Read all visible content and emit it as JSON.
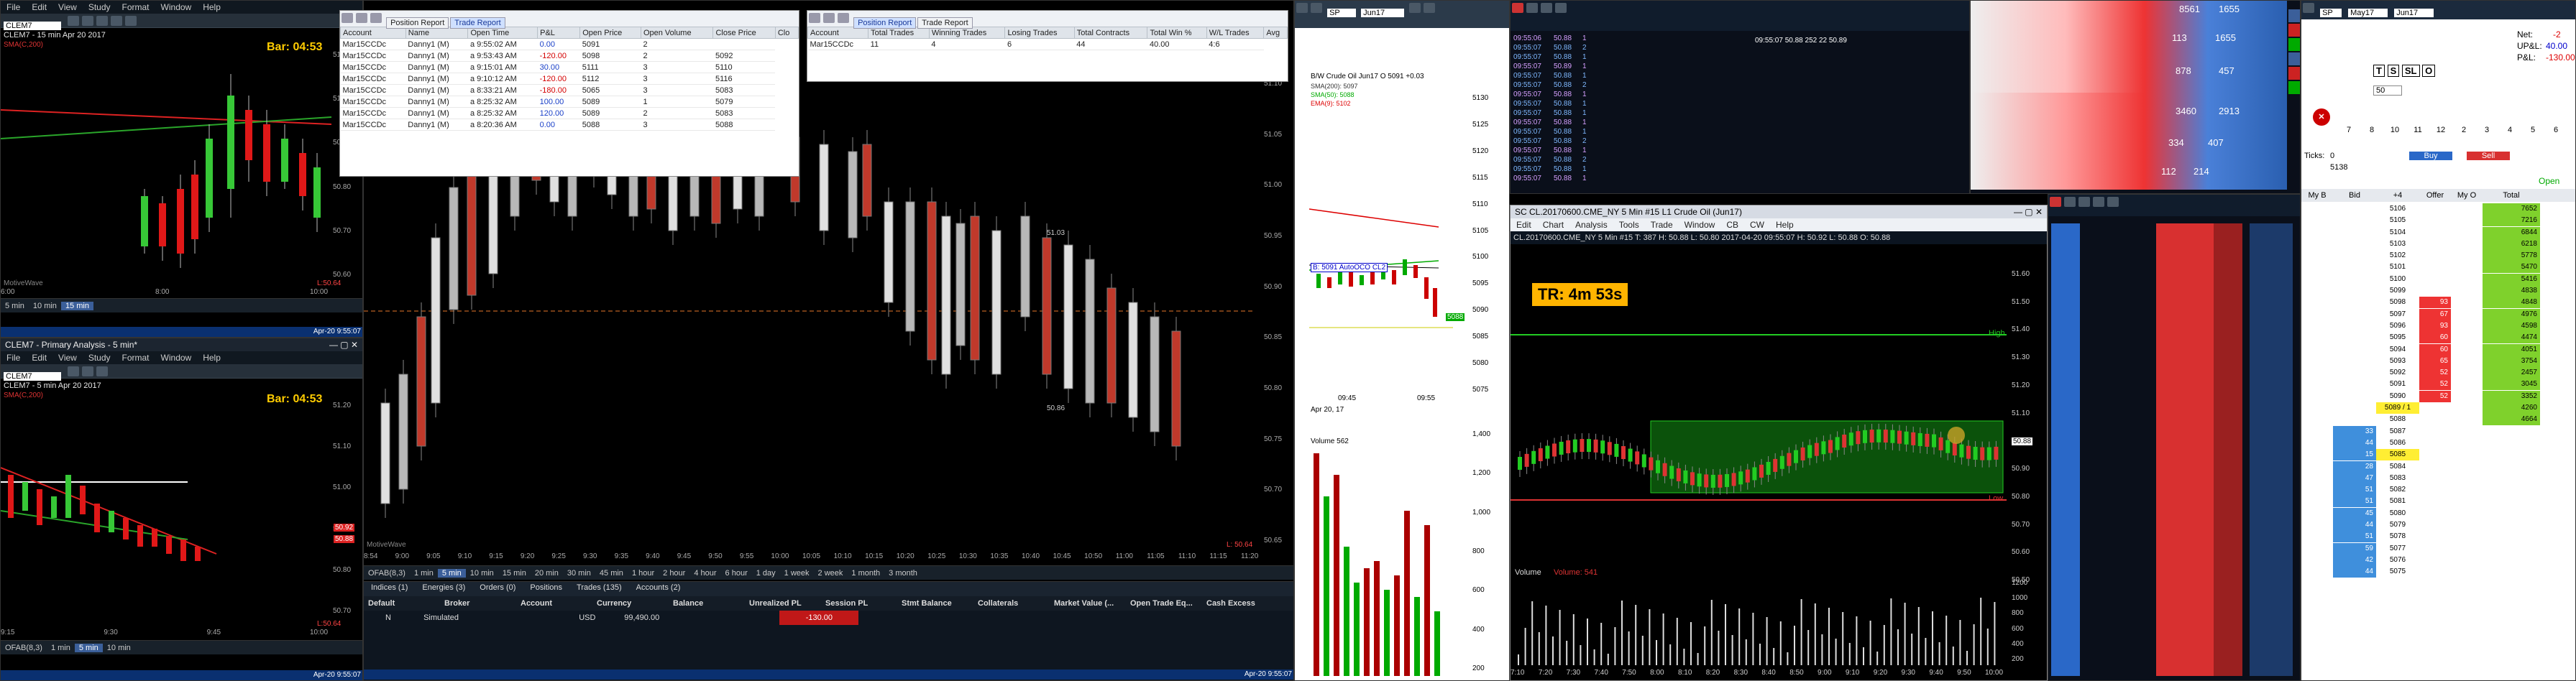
{
  "clem7_top": {
    "title": "CLEM7 - 15 min",
    "menu": [
      "File",
      "Edit",
      "View",
      "Study",
      "Format",
      "Window",
      "Help"
    ],
    "symbol": "CLEM7",
    "header_line": "CLEM7 - 15 min  Apr 20 2017",
    "sma": "SMA(C,200)",
    "bar_countdown": "Bar: 04:53",
    "price_labels": [
      "51.10",
      "51.00",
      "50.90",
      "50.80",
      "50.70",
      "50.60"
    ],
    "low_label": "L:50.64",
    "watermark": "MotiveWave",
    "timeframes": [
      "5 min",
      "10 min",
      "15 min"
    ],
    "time_labels": [
      "6:00",
      "8:00",
      "10:00"
    ],
    "status_date": "Apr-20 9:55:07"
  },
  "clem7_bottom": {
    "title": "CLEM7 - Primary Analysis - 5 min*",
    "menu": [
      "File",
      "Edit",
      "View",
      "Study",
      "Format",
      "Window",
      "Help"
    ],
    "symbol": "CLEM7",
    "header_line": "CLEM7 - 5 min  Apr 20 2017",
    "sma": "SMA(C,200)",
    "bar_countdown": "Bar: 04:53",
    "price_labels": [
      "51.20",
      "51.10",
      "51.00",
      "50.90",
      "50.80",
      "50.70"
    ],
    "price_tags": [
      "50.92",
      "50.88"
    ],
    "low_label": "L:50.64",
    "time_labels": [
      "9:15",
      "9:30",
      "9:45",
      "10:00"
    ],
    "timeframes": [
      "OFAB(8,3)",
      "1 min",
      "5 min",
      "10 min"
    ],
    "status_date": "Apr-20 9:55:07"
  },
  "position_report": {
    "tabs": [
      "Position Report",
      "Trade Report"
    ],
    "columns": [
      "Account",
      "Name",
      "Open Time",
      "P&L",
      "Open Price",
      "Open Volume",
      "Close Price",
      "Clo"
    ],
    "rows": [
      [
        "Mar15CCDc",
        "Danny1 (M)",
        "a 9:55:02 AM",
        "0.00",
        "5091",
        "2",
        ""
      ],
      [
        "Mar15CCDc",
        "Danny1 (M)",
        "a 9:53:43 AM",
        "-120.00",
        "5098",
        "2",
        "5092"
      ],
      [
        "Mar15CCDc",
        "Danny1 (M)",
        "a 9:15:01 AM",
        "30.00",
        "5111",
        "3",
        "5110"
      ],
      [
        "Mar15CCDc",
        "Danny1 (M)",
        "a 9:10:12 AM",
        "-120.00",
        "5112",
        "3",
        "5116"
      ],
      [
        "Mar15CCDc",
        "Danny1 (M)",
        "a 8:33:21 AM",
        "-180.00",
        "5065",
        "3",
        "5083"
      ],
      [
        "Mar15CCDc",
        "Danny1 (M)",
        "a 8:25:32 AM",
        "100.00",
        "5089",
        "1",
        "5079"
      ],
      [
        "Mar15CCDc",
        "Danny1 (M)",
        "a 8:25:32 AM",
        "120.00",
        "5089",
        "2",
        "5083"
      ],
      [
        "Mar15CCDc",
        "Danny1 (M)",
        "a 8:20:36 AM",
        "0.00",
        "5088",
        "3",
        "5088"
      ]
    ]
  },
  "trade_report": {
    "tabs": [
      "Position Report",
      "Trade Report"
    ],
    "columns": [
      "Account",
      "Total Trades",
      "Winning Trades",
      "Losing Trades",
      "Total Contracts",
      "Total Win %",
      "W/L Trades",
      "Avg"
    ],
    "rows": [
      [
        "Mar15CCDc",
        "11",
        "4",
        "6",
        "44",
        "40.00",
        "4:6"
      ]
    ]
  },
  "main_chart": {
    "price_labels": [
      "51.10",
      "51.05",
      "51.00",
      "50.95",
      "50.90",
      "50.85",
      "50.80",
      "50.75",
      "50.70",
      "50.65"
    ],
    "inner_labels": [
      "51.03",
      "50.86"
    ],
    "low_label": "L: 50.64",
    "watermark": "MotiveWave",
    "time_labels": [
      "8:54",
      "9:00",
      "9:05",
      "9:10",
      "9:15",
      "9:20",
      "9:25",
      "9:30",
      "9:35",
      "9:40",
      "9:45",
      "9:50",
      "9:55",
      "10:00",
      "10:05",
      "10:10",
      "10:15",
      "10:20",
      "10:25",
      "10:30",
      "10:35",
      "10:40",
      "10:45",
      "10:50",
      "11:00",
      "11:05",
      "11:10",
      "11:15",
      "11:20"
    ],
    "toolbar": [
      "OFAB(8,3)",
      "1 min",
      "5 min",
      "10 min",
      "15 min",
      "20 min",
      "30 min",
      "45 min",
      "1 hour",
      "2 hour",
      "4 hour",
      "6 hour",
      "1 day",
      "1 week",
      "2 week",
      "1 month",
      "3 month"
    ]
  },
  "accounts_panel": {
    "tabs": [
      "Indices (1)",
      "Energies (3)",
      "Orders (0)",
      "Positions",
      "Trades (135)",
      "Accounts (2)"
    ],
    "columns": [
      "Default",
      "Broker",
      "Account",
      "Currency",
      "Balance",
      "Unrealized PL",
      "Session PL",
      "Stmt Balance",
      "Collaterals",
      "Market Value (...",
      "Open Trade Eq...",
      "Cash Excess"
    ],
    "row": {
      "default": "N",
      "broker": "Simulated",
      "account": "",
      "currency": "USD",
      "balance": "99,490.00",
      "unrealized": "",
      "session_pl": "-130.00"
    },
    "status_date": "Apr-20 9:55:07"
  },
  "small_chart": {
    "title": "B/W Crude Oil Jun17 O 5091 +0.03",
    "legend": [
      "SMA(200): 5097",
      "SMA(50): 5088",
      "EMA(9): 5102"
    ],
    "price_labels": [
      "5130",
      "5125",
      "5120",
      "5115",
      "5110",
      "5105",
      "5100",
      "5095",
      "5090",
      "5085",
      "5080",
      "5075"
    ],
    "autooco": "B: 5091 AutoOCO CL2",
    "tag_price": "5088",
    "time_labels": [
      "09:45",
      "09:55"
    ],
    "date_label": "Apr 20, 17",
    "symbol_box": "SP",
    "contract": "Jun17",
    "volume_label": "Volume 562",
    "volume_axis": [
      "1,400",
      "1,200",
      "1,000",
      "800",
      "600",
      "400",
      "200"
    ]
  },
  "cl_chart": {
    "title": "SC CL.20170600.CME_NY  5 Min  #15  L1  Crude Oil (Jun17)",
    "menu": [
      "Edit",
      "Chart",
      "Analysis",
      "Tools",
      "Trade",
      "Window",
      "CB",
      "CW",
      "Help"
    ],
    "header": "CL.20170600.CME_NY  5 Min  #15  T: 387  H: 50.88  L: 50.80   2017-04-20 09:55:07  H: 50.92  L: 50.88  O: 50.88",
    "tr_label": "TR: 4m 53s",
    "high_label": "High",
    "low_label": "Low",
    "price_labels": [
      "51.60",
      "51.50",
      "51.40",
      "51.30",
      "51.20",
      "51.10",
      "51.00",
      "50.90",
      "50.80",
      "50.70",
      "50.60",
      "50.50"
    ],
    "current_price": "50.88",
    "volume_label": "Volume",
    "volume_value": "Volume: 541",
    "volume_axis": [
      "1200",
      "1000",
      "800",
      "600",
      "400",
      "200"
    ],
    "time_labels": [
      "7:10",
      "7:20",
      "7:30",
      "7:40",
      "7:50",
      "8:00",
      "8:10",
      "8:20",
      "8:30",
      "8:40",
      "8:50",
      "9:00",
      "9:10",
      "9:20",
      "9:30",
      "9:40",
      "9:50",
      "10:00"
    ]
  },
  "time_sales": {
    "rows": [
      [
        "09:55:06",
        "50.88",
        "1"
      ],
      [
        "09:55:07",
        "50.88",
        "2"
      ],
      [
        "09:55:07",
        "50.88",
        "1"
      ],
      [
        "09:55:07",
        "50.89",
        "1"
      ],
      [
        "09:55:07",
        "50.88",
        "1"
      ],
      [
        "09:55:07",
        "50.88",
        "2"
      ],
      [
        "09:55:07",
        "50.88",
        "1"
      ],
      [
        "09:55:07",
        "50.88",
        "1"
      ],
      [
        "09:55:07",
        "50.88",
        "1"
      ],
      [
        "09:55:07",
        "50.88",
        "1"
      ],
      [
        "09:55:07",
        "50.88",
        "1"
      ],
      [
        "09:55:07",
        "50.88",
        "2"
      ],
      [
        "09:55:07",
        "50.88",
        "1"
      ],
      [
        "09:55:07",
        "50.88",
        "2"
      ],
      [
        "09:55:07",
        "50.88",
        "1"
      ],
      [
        "09:55:07",
        "50.88",
        "1"
      ]
    ],
    "dom_header": "09:55:07  50.88  252  22  50.89"
  },
  "order_ticket": {
    "symbol": "SP",
    "contract": "May17",
    "contract2": "Jun17",
    "net": "-2",
    "upl": "40.00",
    "pl": "-130.00",
    "net_label": "Net:",
    "upl_label": "UP&L:",
    "pl_label": "P&L:",
    "qty": "50",
    "ticks_label": "Ticks:",
    "ticks": "0",
    "price_5138": "5138",
    "buy": "Buy",
    "sell": "Sell",
    "open": "Open",
    "buttons": [
      "T",
      "S",
      "SL",
      "O"
    ],
    "header_nums": [
      "7",
      "8",
      "10",
      "11",
      "12",
      "2",
      "3",
      "4",
      "5",
      "6"
    ]
  },
  "dom_ladder": {
    "columns": [
      "My B",
      "Bid",
      "+4",
      "Offer",
      "My O",
      "Total"
    ],
    "prices": [
      "5106",
      "5105",
      "5104",
      "5103",
      "5102",
      "5101",
      "5100",
      "5099",
      "5098",
      "5097",
      "5096",
      "5095",
      "5094",
      "5093",
      "5092",
      "5091",
      "5090",
      "5089",
      "5088",
      "5087",
      "5086",
      "5085",
      "5084",
      "5083",
      "5082",
      "5081",
      "5080",
      "5079",
      "5078",
      "5077",
      "5076",
      "5075"
    ],
    "offers": [
      "",
      "",
      "",
      "",
      "",
      "",
      "",
      "",
      "93",
      "67",
      "93",
      "60",
      "60",
      "65",
      "52",
      "52",
      "52",
      "",
      "",
      "",
      "",
      "",
      "",
      "",
      "",
      "",
      "",
      "",
      "",
      "",
      "",
      ""
    ],
    "bids": [
      "",
      "",
      "",
      "",
      "",
      "",
      "",
      "",
      "",
      "",
      "",
      "",
      "",
      "",
      "",
      "",
      "",
      "",
      "",
      "33",
      "44",
      "15",
      "28",
      "47",
      "51",
      "51",
      "45",
      "44",
      "51",
      "59",
      "42",
      "44"
    ],
    "totals": [
      "7652",
      "7216",
      "6844",
      "6218",
      "5778",
      "5470",
      "5416",
      "4838",
      "4848",
      "4976",
      "4598",
      "4474",
      "4051",
      "3754",
      "2457",
      "3045",
      "3352",
      "4260",
      "4664",
      "",
      "",
      "",
      "",
      "",
      "",
      "",
      "",
      "",
      "",
      "",
      "",
      ""
    ],
    "current": "5089 / 1",
    "current_bid": "5085"
  },
  "depth_panel": {
    "nums_a": [
      "8561",
      "1655",
      "113",
      "1655",
      "878",
      "457",
      "3460",
      "2913",
      "334",
      "407",
      "112",
      "214"
    ]
  },
  "colors": {
    "up": "#37c837",
    "down": "#e01818",
    "accent": "#3b5f9a",
    "ladder_green": "#7fd12c",
    "ladder_red": "#ee3333",
    "ladder_blue": "#3f8fdc"
  }
}
